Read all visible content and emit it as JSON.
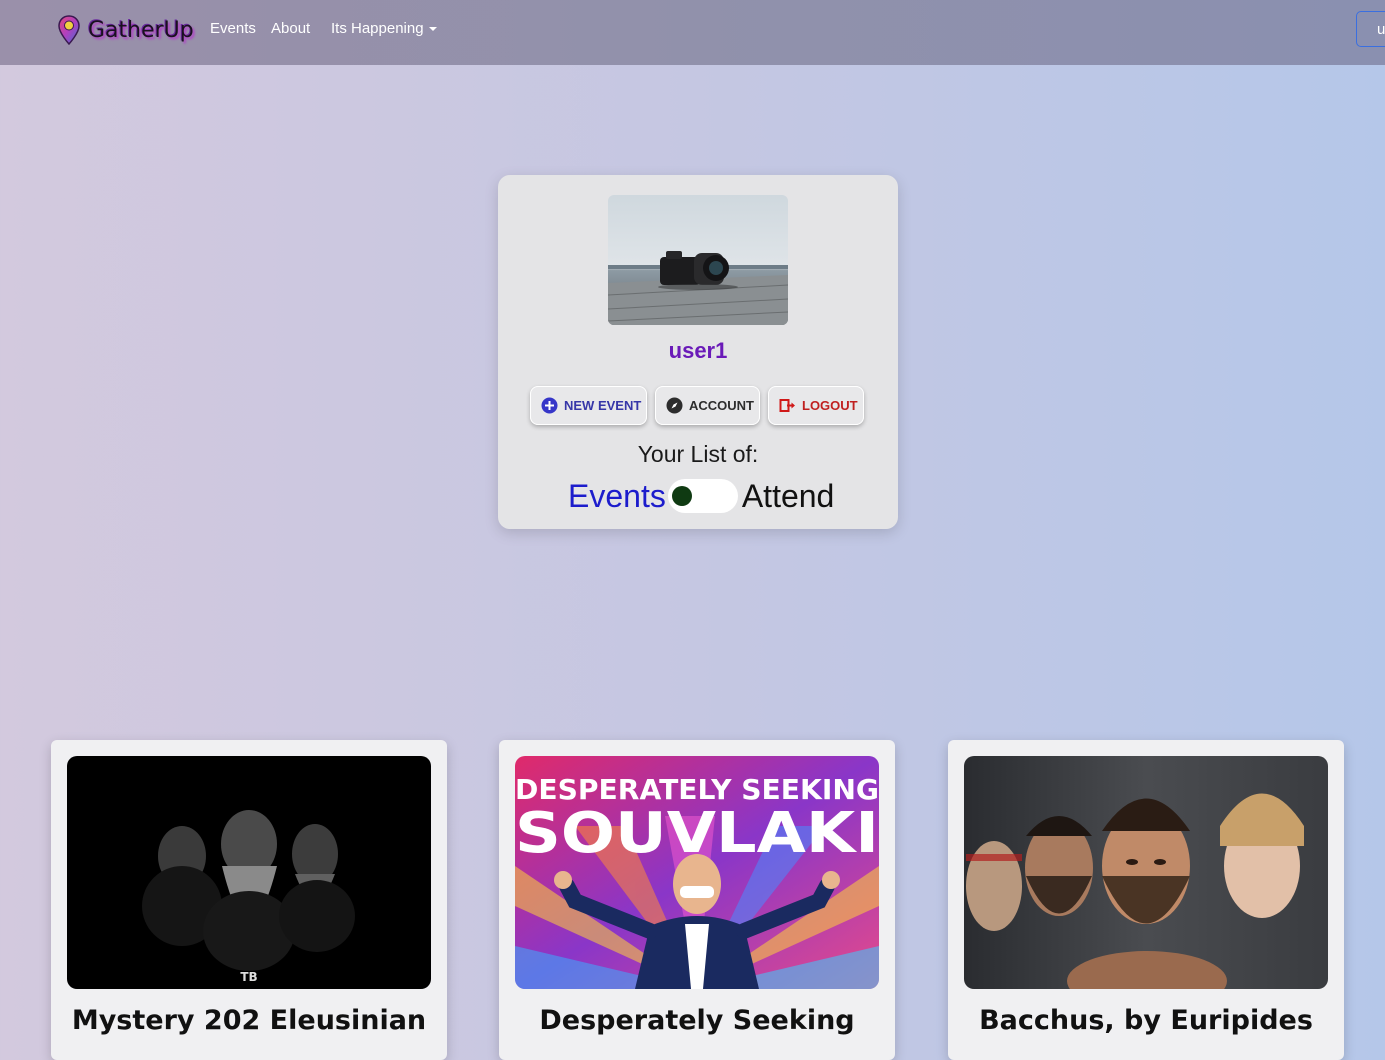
{
  "navbar": {
    "brand": "GatherUp",
    "links": [
      "Events",
      "About",
      "Its Happening"
    ],
    "user_button": "u"
  },
  "profile": {
    "username": "user1",
    "buttons": {
      "new_event": "NEW EVENT",
      "account": "ACCOUNT",
      "logout": "LOGOUT"
    },
    "list_label": "Your List of:",
    "toggle": {
      "left_label": "Events",
      "right_label": "Attend",
      "selected": "Events"
    }
  },
  "events": [
    {
      "title": "Mystery 202 Eleusinian"
    },
    {
      "title": "Desperately Seeking",
      "poster_line1": "DESPERATELY SEEKING",
      "poster_line2": "SOUVLAKI"
    },
    {
      "title": "Bacchus, by Euripides"
    }
  ],
  "colors": {
    "username": "#6a1ab8",
    "new_event": "#3636a8",
    "logout": "#c02020",
    "toggle_events": "#1c1ccc",
    "toggle_knob": "#0f3a12"
  }
}
